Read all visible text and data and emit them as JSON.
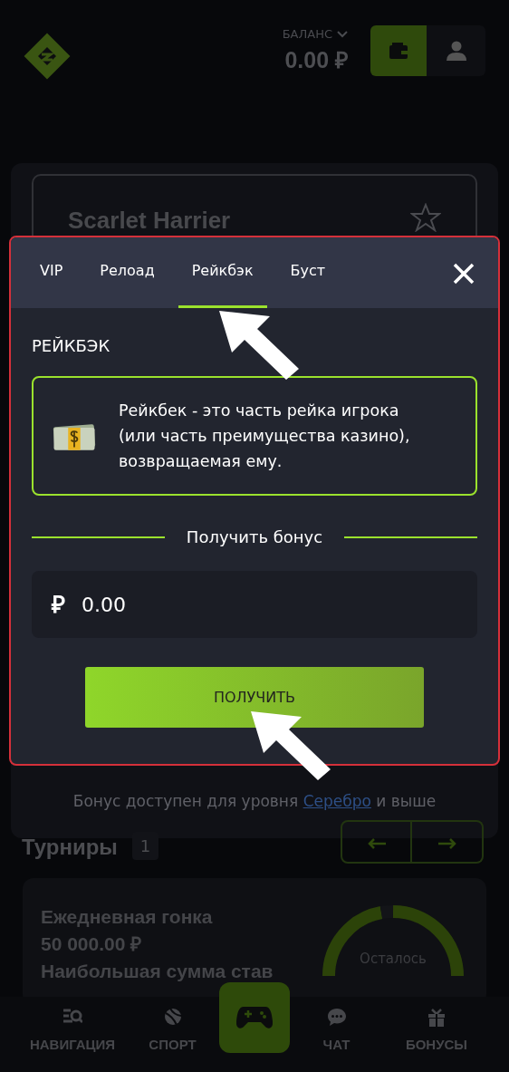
{
  "header": {
    "balance_label": "БАЛАНС",
    "balance": "0.00 ₽"
  },
  "bonus_card": {
    "title": "Scarlet Harrier",
    "favorite": false,
    "footer_text": "Бонус доступен для уровня",
    "footer_link": "Серебро",
    "footer_suffix": "и выше"
  },
  "tournaments": {
    "title": "Турниры",
    "count": "1",
    "card": {
      "name": "Ежедневная гонка",
      "amount": "50 000.00 ₽",
      "description": "Наибольшая сумма став",
      "timer_label": "Осталось"
    }
  },
  "bottom_nav": [
    {
      "kind": "navigation",
      "label": "НАВИГАЦИЯ",
      "selected": false
    },
    {
      "kind": "sport",
      "label": "СПОРТ",
      "selected": false
    },
    {
      "kind": "games",
      "selected": true
    },
    {
      "kind": "chat",
      "label": "ЧАТ",
      "selected": false
    },
    {
      "kind": "bonuses",
      "label": "БОНУСЫ",
      "selected": false
    }
  ],
  "modal": {
    "highlighted": true,
    "tabs": [
      {
        "label": "VIP",
        "selected": false,
        "annotated": false
      },
      {
        "label": "Релоад",
        "selected": false,
        "annotated": false
      },
      {
        "label": "Рейкбэк",
        "selected": true,
        "annotated": true
      },
      {
        "label": "Буст",
        "selected": false,
        "annotated": false
      }
    ],
    "heading": "РЕЙКБЭК",
    "info": "Рейкбек - это часть рейка игрока (или часть преимущества казино), возвращаемая ему.",
    "divider_label": "Получить бонус",
    "amount_field": {
      "currency": "₽",
      "value": "0.00"
    },
    "submit": {
      "label": "ПОЛУЧИТЬ",
      "annotated": true
    }
  }
}
